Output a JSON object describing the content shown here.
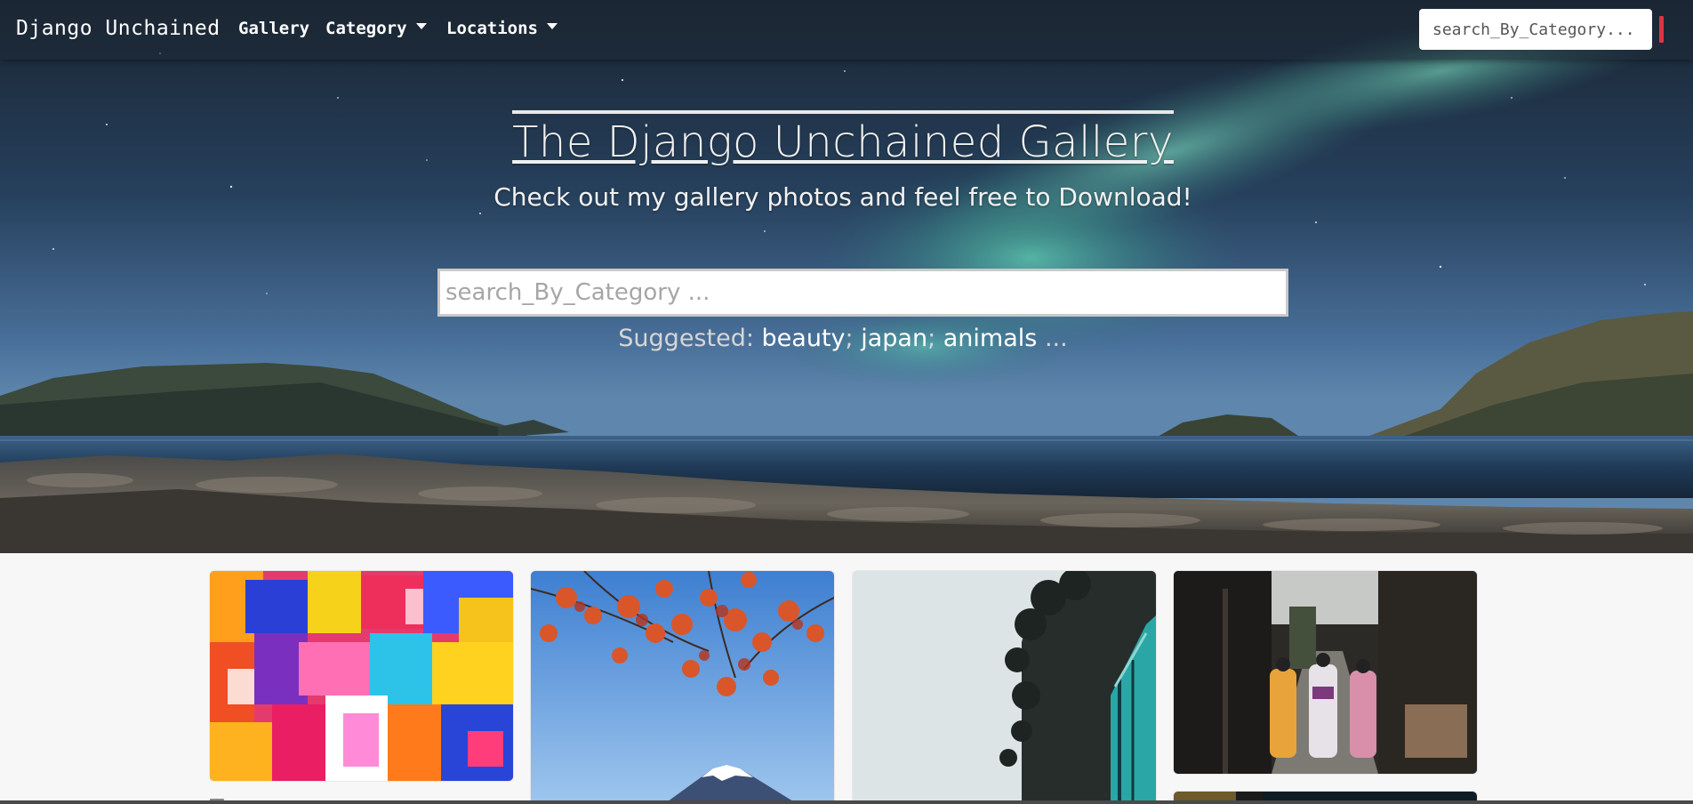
{
  "navbar": {
    "brand": "Django Unchained",
    "items": [
      {
        "label": "Gallery",
        "has_dropdown": false
      },
      {
        "label": "Category",
        "has_dropdown": true
      },
      {
        "label": "Locations",
        "has_dropdown": true
      }
    ],
    "search_placeholder": "search_By_Category...",
    "accent_color": "#dc3545"
  },
  "hero": {
    "title": "The Django Unchained Gallery",
    "subtitle": "Check out my gallery photos and feel free to Download!",
    "search_placeholder": "search_By_Category ...",
    "suggested_label": "Suggested:",
    "suggested_tags": [
      "beauty",
      "japan",
      "animals"
    ],
    "suggested_more": "..."
  },
  "gallery": {
    "cards": [
      {
        "subject": "abstract-painting-image"
      },
      {
        "subject": "mount-fuji-maple-image"
      },
      {
        "subject": "forest-train-image"
      },
      {
        "subject": "kimono-street-image"
      },
      {
        "subject": "dark-photo-image"
      }
    ]
  }
}
